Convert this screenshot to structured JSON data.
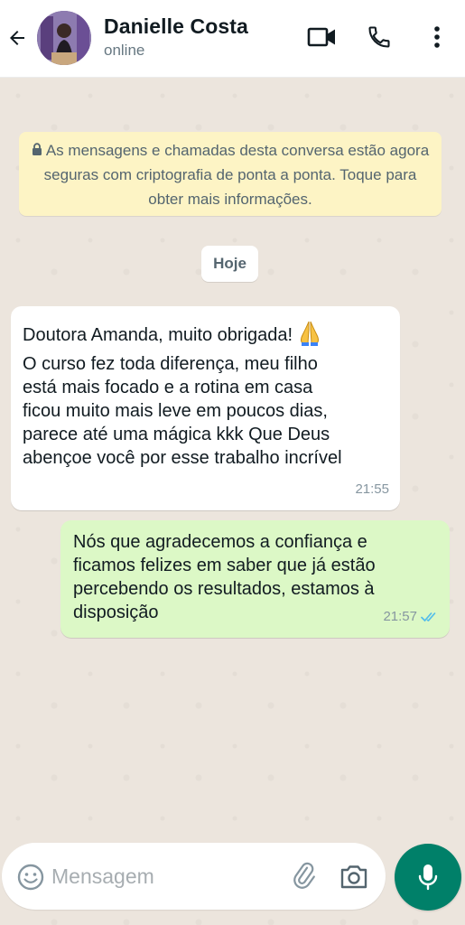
{
  "header": {
    "contact_name": "Danielle Costa",
    "status": "online",
    "icons": [
      "back-arrow-icon",
      "video-call-icon",
      "voice-call-icon",
      "more-options-icon"
    ]
  },
  "notice": {
    "text": "As mensagens e chamadas desta conversa estão agora seguras com criptografia de ponta a ponta. Toque para obter mais informações.",
    "icon": "lock-icon"
  },
  "date_chip": {
    "label": "Hoje"
  },
  "messages": [
    {
      "direction": "incoming",
      "lines": [
        "Doutora Amanda, muito obrigada!",
        "O curso fez toda diferença, meu filho",
        "está mais focado e a rotina em casa",
        "ficou muito mais leve em poucos dias,",
        "parece até uma mágica kkk Que Deus",
        "abençoe você por esse trabalho incrível"
      ],
      "emoji": "🙏",
      "time": "21:55"
    },
    {
      "direction": "outgoing",
      "lines": [
        "Nós que agradecemos a confiança e",
        "ficamos felizes em saber que já estão",
        "percebendo os resultados, estamos à",
        "disposição"
      ],
      "time": "21:57",
      "read_status": "double-check-blue-icon"
    }
  ],
  "composer": {
    "placeholder": "Mensagem",
    "value": "",
    "icons": [
      "emoji-icon",
      "attach-icon",
      "camera-icon",
      "mic-icon"
    ]
  },
  "colors": {
    "header_bg": "#ffffff",
    "chat_bg": "#ece5dd",
    "notice_bg": "#fdf4c5",
    "incoming_bubble": "#ffffff",
    "outgoing_bubble": "#dcf8c6",
    "accent": "#008069",
    "read_tick": "#53bdeb"
  }
}
